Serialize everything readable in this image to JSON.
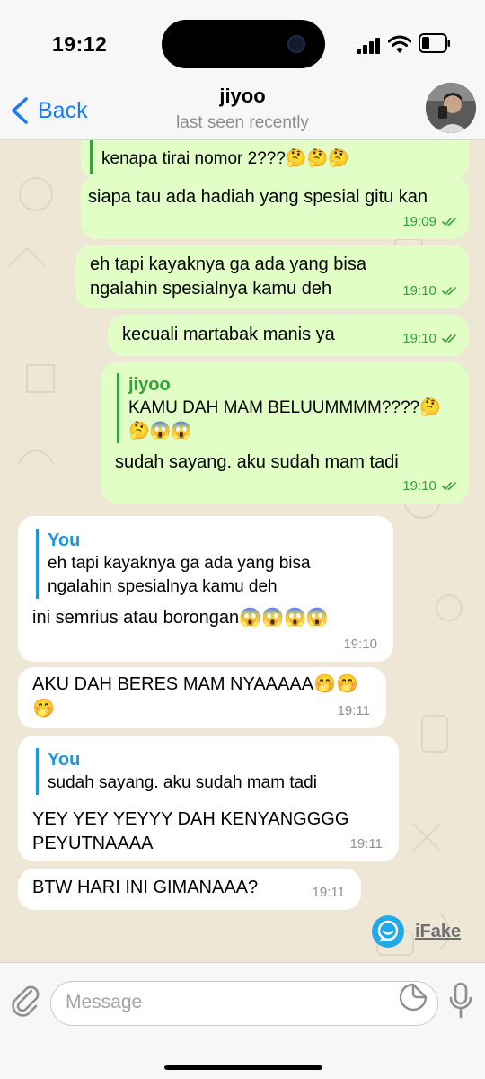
{
  "status_bar": {
    "time": "19:12"
  },
  "header": {
    "back_label": "Back",
    "contact_name": "jiyoo",
    "contact_status": "last seen recently"
  },
  "messages": [
    {
      "id": "m1",
      "dir": "out",
      "quote_text": "kenapa tirai nomor 2???🤔🤔🤔"
    },
    {
      "id": "m2",
      "dir": "out",
      "text": "siapa tau ada hadiah yang spesial gitu kan",
      "time": "19:09"
    },
    {
      "id": "m3",
      "dir": "out",
      "text": "eh tapi kayaknya ga ada yang bisa ngalahin spesialnya kamu deh",
      "time": "19:10"
    },
    {
      "id": "m4",
      "dir": "out",
      "text": "kecuali martabak manis ya",
      "time": "19:10"
    },
    {
      "id": "m5",
      "dir": "out",
      "quote_name": "jiyoo",
      "quote_text": "KAMU DAH MAM BELUUMMMM????🤔🤔😱😱",
      "text": "sudah sayang. aku sudah mam tadi",
      "time": "19:10"
    },
    {
      "id": "m6",
      "dir": "in",
      "quote_name": "You",
      "quote_text": "eh tapi kayaknya ga ada yang bisa ngalahin spesialnya kamu deh",
      "text": "ini semrius atau borongan😱😱😱😱",
      "time": "19:10"
    },
    {
      "id": "m7",
      "dir": "in",
      "text": "AKU DAH BERES MAM NYAAAAA🤭🤭🤭",
      "time": "19:11"
    },
    {
      "id": "m8",
      "dir": "in",
      "quote_name": "You",
      "quote_text": "sudah sayang. aku sudah mam tadi",
      "text": "YEY YEY YEYYY DAH KENYANGGGG PEYUTNAAAA",
      "time": "19:11"
    },
    {
      "id": "m9",
      "dir": "in",
      "text": "BTW HARI INI GIMANAAA?",
      "time": "19:11"
    }
  ],
  "watermark": {
    "label": "iFake"
  },
  "input": {
    "placeholder": "Message"
  },
  "colors": {
    "outgoing_bubble": "#e1fec6",
    "incoming_bubble": "#ffffff",
    "accent_blue": "#1a7cf4",
    "read_check_green": "#35a136",
    "wallpaper": "#efe7d6"
  },
  "icons": [
    "signal-icon",
    "wifi-icon",
    "battery-icon",
    "back-chevron-icon",
    "read-check-icon",
    "ifake-logo-icon",
    "attach-icon",
    "sticker-icon",
    "mic-icon"
  ]
}
